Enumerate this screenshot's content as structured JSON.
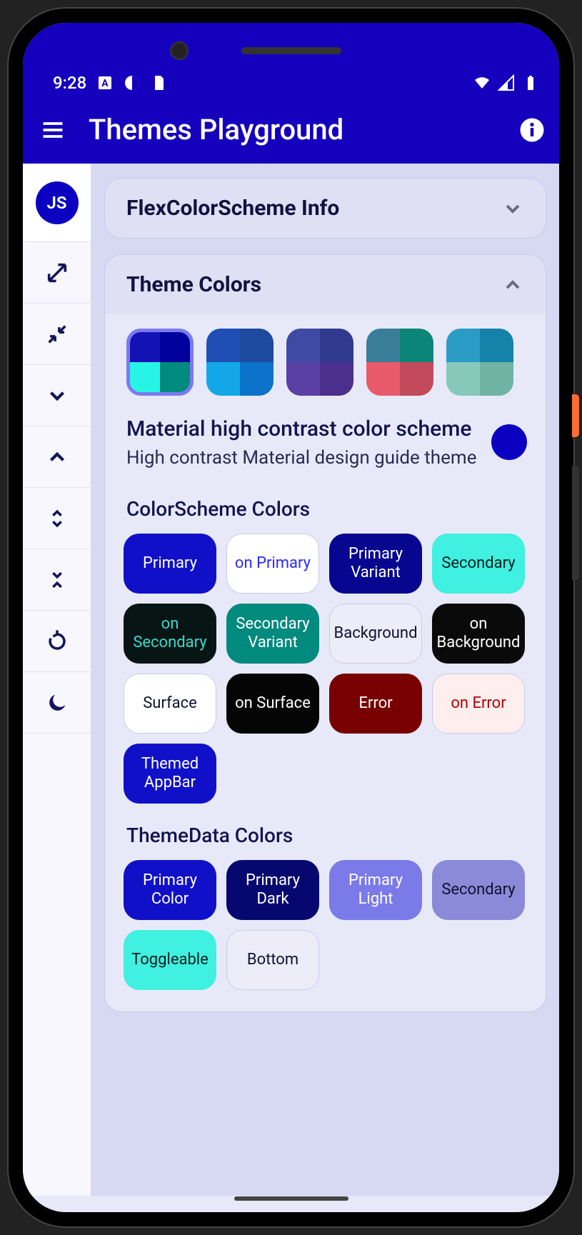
{
  "status": {
    "time": "9:28"
  },
  "appbar": {
    "title": "Themes Playground"
  },
  "rail": {
    "avatar": "JS"
  },
  "cards": {
    "info": {
      "title": "FlexColorScheme Info"
    },
    "themeColors": {
      "title": "Theme Colors",
      "schemeTitle": "Material high contrast color scheme",
      "schemeSubtitle": "High contrast Material design guide theme",
      "colorSchemeLabel": "ColorScheme Colors",
      "themeDataLabel": "ThemeData Colors"
    }
  },
  "swatches": [
    {
      "c": [
        "#1212b5",
        "#00009c",
        "#26f5e6",
        "#018a7e"
      ],
      "selected": true
    },
    {
      "c": [
        "#1f4fb5",
        "#1e4aa0",
        "#13a7e8",
        "#0b73c9"
      ],
      "selected": false
    },
    {
      "c": [
        "#3f4aa5",
        "#303a8e",
        "#5a3fa5",
        "#4a2f8c"
      ],
      "selected": false
    },
    {
      "c": [
        "#3a7d99",
        "#0a8578",
        "#e85a6a",
        "#c34a5a"
      ],
      "selected": false
    },
    {
      "c": [
        "#2a9cc6",
        "#1582aa",
        "#86c8b9",
        "#6eb3a3"
      ],
      "selected": false
    }
  ],
  "colorSchemeChips": [
    {
      "label": "Primary",
      "bg": "#1010c9",
      "fg": "#ffffff"
    },
    {
      "label": "on Primary",
      "bg": "#ffffff",
      "fg": "#2b2bff",
      "border": true
    },
    {
      "label": "Primary Variant",
      "bg": "#060690",
      "fg": "#ffffff"
    },
    {
      "label": "Secondary",
      "bg": "#40f0e0",
      "fg": "#042020"
    },
    {
      "label": "on Secondary",
      "bg": "#071515",
      "fg": "#3adacb"
    },
    {
      "label": "Secondary Variant",
      "bg": "#018a7e",
      "fg": "#ffffff"
    },
    {
      "label": "Background",
      "bg": "#ecedf8",
      "fg": "#101030",
      "border": true
    },
    {
      "label": "on Background",
      "bg": "#0a0a0a",
      "fg": "#ffffff"
    },
    {
      "label": "Surface",
      "bg": "#ffffff",
      "fg": "#101030",
      "border": true
    },
    {
      "label": "on Surface",
      "bg": "#050505",
      "fg": "#ffffff"
    },
    {
      "label": "Error",
      "bg": "#790000",
      "fg": "#ffffff"
    },
    {
      "label": "on Error",
      "bg": "#ffeeee",
      "fg": "#b50000",
      "border": true
    },
    {
      "label": "Themed AppBar",
      "bg": "#1010c9",
      "fg": "#ffffff"
    }
  ],
  "themeDataChips": [
    {
      "label": "Primary Color",
      "bg": "#1010c9",
      "fg": "#ffffff"
    },
    {
      "label": "Primary Dark",
      "bg": "#070770",
      "fg": "#ffffff"
    },
    {
      "label": "Primary Light",
      "bg": "#7a7ae8",
      "fg": "#ffffff"
    },
    {
      "label": "Secondary",
      "bg": "#8a8ad8",
      "fg": "#101030"
    },
    {
      "label": "Toggleable",
      "bg": "#40f0e0",
      "fg": "#042020"
    },
    {
      "label": "Bottom",
      "bg": "#ecedf8",
      "fg": "#101030",
      "border": true
    }
  ]
}
